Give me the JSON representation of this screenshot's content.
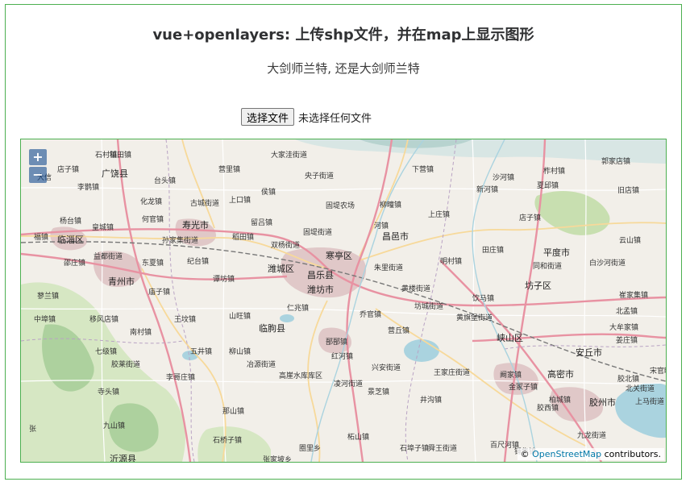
{
  "page": {
    "title": "vue+openlayers: 上传shp文件，并在map上显示图形",
    "subtitle": "大剑师兰特, 还是大剑师兰特"
  },
  "file_input": {
    "button_label": "选择文件",
    "status": "未选择任何文件"
  },
  "map": {
    "zoom_in_label": "+",
    "zoom_out_label": "−",
    "attribution_prefix": "©",
    "attribution_link": "OpenStreetMap",
    "attribution_suffix": "contributors.",
    "place_labels": [
      {
        "text": "石村镇",
        "major": false
      },
      {
        "text": "大家洼街道",
        "major": false
      },
      {
        "text": "稻田镇",
        "major": false
      },
      {
        "text": "下营镇",
        "major": false
      },
      {
        "text": "店子镇",
        "major": false
      },
      {
        "text": "广饶县",
        "major": true
      },
      {
        "text": "营里镇",
        "major": false
      },
      {
        "text": "央子街道",
        "major": false
      },
      {
        "text": "沙河镇",
        "major": false
      },
      {
        "text": "柞村镇",
        "major": false
      },
      {
        "text": "郭家店镇",
        "major": false
      },
      {
        "text": "台头镇",
        "major": false
      },
      {
        "text": "侯镇",
        "major": false
      },
      {
        "text": "新河镇",
        "major": false
      },
      {
        "text": "夏邱镇",
        "major": false
      },
      {
        "text": "旧店镇",
        "major": false
      },
      {
        "text": "李鹊镇",
        "major": false
      },
      {
        "text": "化龙镇",
        "major": false
      },
      {
        "text": "古城街道",
        "major": false
      },
      {
        "text": "上口镇",
        "major": false
      },
      {
        "text": "固堤农场",
        "major": false
      },
      {
        "text": "柳疃镇",
        "major": false
      },
      {
        "text": "上庄镇",
        "major": false
      },
      {
        "text": "杨台镇",
        "major": false
      },
      {
        "text": "何官镇",
        "major": false
      },
      {
        "text": "寿光市",
        "major": true
      },
      {
        "text": "留吕镇",
        "major": false
      },
      {
        "text": "店子镇",
        "major": false
      },
      {
        "text": "皇城镇",
        "major": false
      },
      {
        "text": "固堤街道",
        "major": false
      },
      {
        "text": "昌邑市",
        "major": true
      },
      {
        "text": "临淄区",
        "major": true
      },
      {
        "text": "孙家集街道",
        "major": false
      },
      {
        "text": "稻田镇",
        "major": false
      },
      {
        "text": "双杨街道",
        "major": false
      },
      {
        "text": "田庄镇",
        "major": false
      },
      {
        "text": "云山镇",
        "major": false
      },
      {
        "text": "益都街道",
        "major": false
      },
      {
        "text": "寒亭区",
        "major": true
      },
      {
        "text": "明村镇",
        "major": false
      },
      {
        "text": "平度市",
        "major": true
      },
      {
        "text": "邵庄镇",
        "major": false
      },
      {
        "text": "东夏镇",
        "major": false
      },
      {
        "text": "纪台镇",
        "major": false
      },
      {
        "text": "潍城区",
        "major": true
      },
      {
        "text": "朱里街道",
        "major": false
      },
      {
        "text": "同和街道",
        "major": false
      },
      {
        "text": "白沙河街道",
        "major": false
      },
      {
        "text": "青州市",
        "major": true
      },
      {
        "text": "谭坊镇",
        "major": false
      },
      {
        "text": "昌乐县",
        "major": true
      },
      {
        "text": "潍坊市",
        "major": true
      },
      {
        "text": "坊子区",
        "major": true
      },
      {
        "text": "蓼兰镇",
        "major": false
      },
      {
        "text": "庙子镇",
        "major": false
      },
      {
        "text": "黄楼街道",
        "major": false
      },
      {
        "text": "饮马镇",
        "major": false
      },
      {
        "text": "崔家集镇",
        "major": false
      },
      {
        "text": "仁兆镇",
        "major": false
      },
      {
        "text": "坊城街道",
        "major": false
      },
      {
        "text": "北孟镇",
        "major": false
      },
      {
        "text": "移风店镇",
        "major": false
      },
      {
        "text": "王坟镇",
        "major": false
      },
      {
        "text": "山旺镇",
        "major": false
      },
      {
        "text": "乔官镇",
        "major": false
      },
      {
        "text": "黄旗堡街道",
        "major": false
      },
      {
        "text": "大牟家镇",
        "major": false
      },
      {
        "text": "南村镇",
        "major": false
      },
      {
        "text": "临朐县",
        "major": true
      },
      {
        "text": "营丘镇",
        "major": false
      },
      {
        "text": "峡山区",
        "major": true
      },
      {
        "text": "姜庄镇",
        "major": false
      },
      {
        "text": "七级镇",
        "major": false
      },
      {
        "text": "五井镇",
        "major": false
      },
      {
        "text": "柳山镇",
        "major": false
      },
      {
        "text": "郚郚镇",
        "major": false
      },
      {
        "text": "安丘市",
        "major": true
      },
      {
        "text": "胶莱街道",
        "major": false
      },
      {
        "text": "冶源街道",
        "major": false
      },
      {
        "text": "红河镇",
        "major": false
      },
      {
        "text": "兴安街道",
        "major": false
      },
      {
        "text": "王家庄街道",
        "major": false
      },
      {
        "text": "阚家镇",
        "major": false
      },
      {
        "text": "高密市",
        "major": true
      },
      {
        "text": "胶北镇",
        "major": false
      },
      {
        "text": "李哥庄镇",
        "major": false
      },
      {
        "text": "高崖水库库区",
        "major": false
      },
      {
        "text": "凌河街道",
        "major": false
      },
      {
        "text": "金冢子镇",
        "major": false
      },
      {
        "text": "柏城镇",
        "major": false
      },
      {
        "text": "北关街道",
        "major": false
      },
      {
        "text": "寺头镇",
        "major": false
      },
      {
        "text": "景芝镇",
        "major": false
      },
      {
        "text": "井沟镇",
        "major": false
      },
      {
        "text": "胶西镇",
        "major": false
      },
      {
        "text": "胶州市",
        "major": true
      },
      {
        "text": "上马街道",
        "major": false
      },
      {
        "text": "那山镇",
        "major": false
      },
      {
        "text": "九山镇",
        "major": false
      },
      {
        "text": "九龙街道",
        "major": false
      },
      {
        "text": "柘山镇",
        "major": false
      },
      {
        "text": "石桥子镇",
        "major": false
      },
      {
        "text": "圈里乡",
        "major": false
      },
      {
        "text": "石埠子镇",
        "major": false
      },
      {
        "text": "舜王街道",
        "major": false
      },
      {
        "text": "百尺河镇",
        "major": false
      },
      {
        "text": "铺集镇",
        "major": false
      },
      {
        "text": "张",
        "major": false
      },
      {
        "text": "沂源县",
        "major": true
      },
      {
        "text": "张家坡乡",
        "major": false
      },
      {
        "text": "宋官疃镇",
        "major": false
      },
      {
        "text": "大信",
        "major": false
      },
      {
        "text": "福镇",
        "major": false
      },
      {
        "text": "中埠镇",
        "major": false
      },
      {
        "text": "河镇",
        "major": false
      }
    ]
  }
}
